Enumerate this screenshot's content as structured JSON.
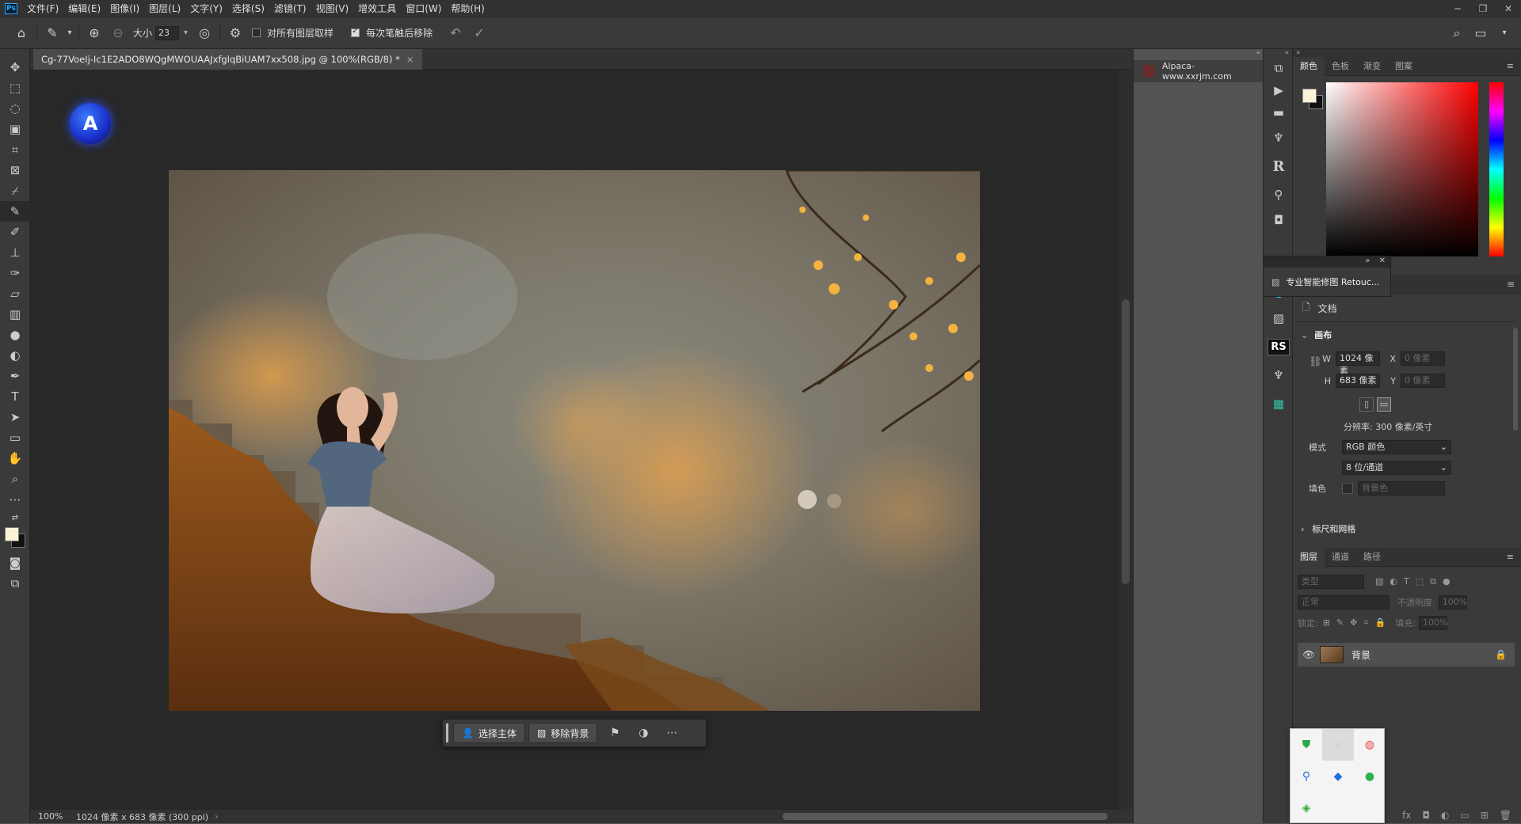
{
  "menubar": {
    "logo": "Ps",
    "items": [
      "文件(F)",
      "编辑(E)",
      "图像(I)",
      "图层(L)",
      "文字(Y)",
      "选择(S)",
      "滤镜(T)",
      "视图(V)",
      "增效工具",
      "窗口(W)",
      "帮助(H)"
    ]
  },
  "options": {
    "size_label": "大小",
    "size_value": "23",
    "sample_all_label": "对所有图层取样",
    "sample_all_checked": false,
    "remove_after_label": "每次笔触后移除",
    "remove_after_checked": true
  },
  "document": {
    "tab_title": "Cg-77VoeIj-Ic1E2ADO8WQgMWOUAAJxfglqBiUAM7xx508.jpg @ 100%(RGB/8) *",
    "close": "×"
  },
  "status": {
    "zoom": "100%",
    "info": "1024 像素 x 683 像素 (300 ppi)",
    "arrow": "›"
  },
  "context_bar": {
    "select_subject": "选择主体",
    "remove_bg": "移除背景"
  },
  "plugins_panel": {
    "item": "Alpaca-www.xxrjm.com"
  },
  "float_panel": {
    "title": "专业智能修图 Retouc...",
    "close": "✕"
  },
  "color_panel": {
    "tabs": [
      "颜色",
      "色板",
      "渐变",
      "图案"
    ],
    "foreground": "#faf3d7",
    "background": "#111111"
  },
  "properties": {
    "doc_label": "文档",
    "canvas_section": "画布",
    "w_label": "W",
    "w_value": "1024 像素",
    "h_label": "H",
    "h_value": "683 像素",
    "x_label": "X",
    "x_value": "0 像素",
    "y_label": "Y",
    "y_value": "0 像素",
    "resolution": "分辨率: 300 像素/英寸",
    "mode_label": "模式",
    "mode_value": "RGB 颜色",
    "depth_value": "8 位/通道",
    "fill_label": "填色",
    "fill_value": "背景色",
    "next_section": "标尺和网格"
  },
  "layers_panel": {
    "tabs": [
      "图层",
      "通道",
      "路径"
    ],
    "search_placeholder": "类型",
    "blend_mode": "正常",
    "opacity_label": "不透明度:",
    "opacity_value": "100%",
    "lock_label": "锁定:",
    "fill_label": "填充:",
    "fill_value": "100%",
    "layer_name": "背景"
  }
}
